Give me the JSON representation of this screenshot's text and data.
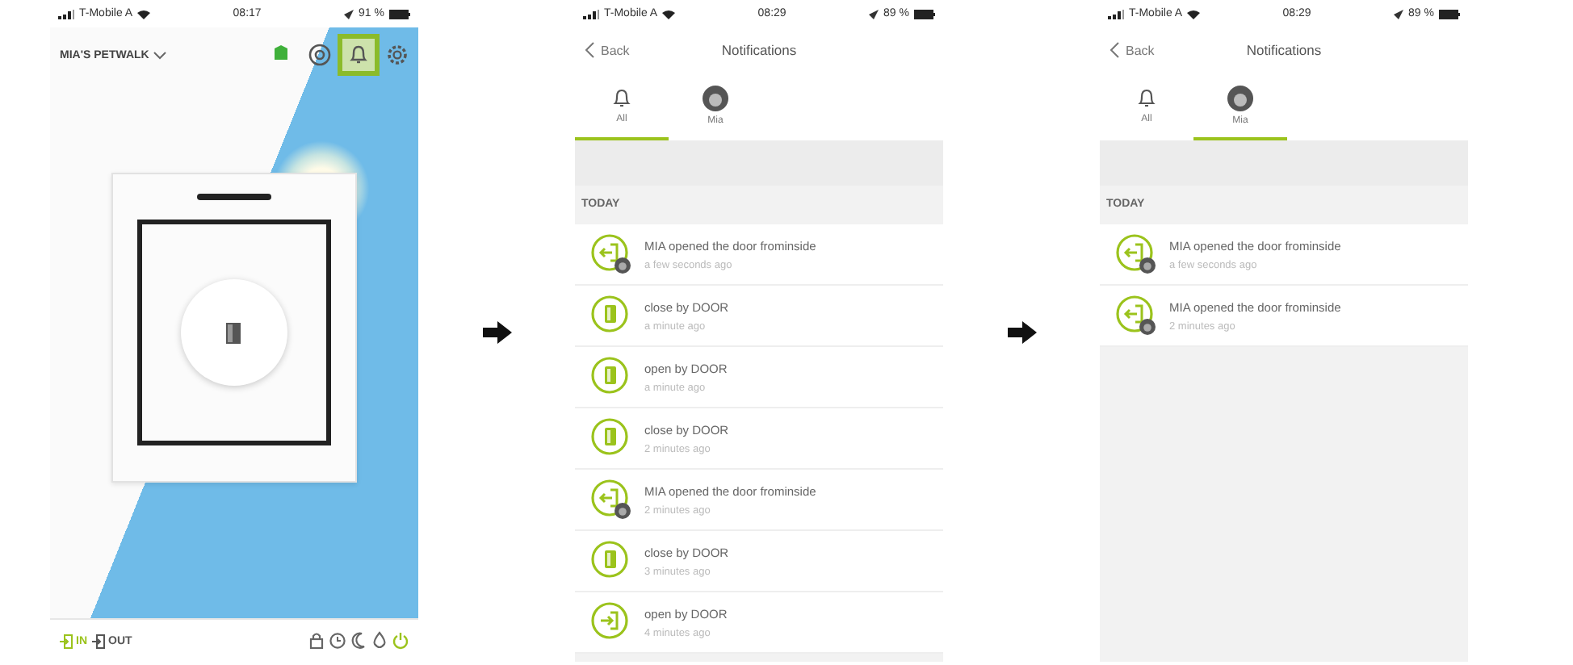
{
  "screens": [
    {
      "kind": "home",
      "status_bar": {
        "carrier": "T-Mobile A",
        "time": "08:17",
        "battery": "91 %"
      },
      "title": "MIA'S PETWALK",
      "header_icons": [
        {
          "kind": "status",
          "highlighted": false
        },
        {
          "kind": "camera",
          "highlighted": false
        },
        {
          "kind": "bell",
          "highlighted": true
        },
        {
          "kind": "gear",
          "highlighted": false
        }
      ],
      "directions": [
        {
          "label": "IN",
          "selected": true
        },
        {
          "label": "OUT",
          "selected": false
        }
      ],
      "modes": [
        {
          "kind": "lock",
          "active": false
        },
        {
          "kind": "clock",
          "active": false
        },
        {
          "kind": "moon",
          "active": false
        },
        {
          "kind": "drop",
          "active": false
        },
        {
          "kind": "power",
          "active": true
        }
      ]
    },
    {
      "kind": "notifications",
      "status_bar": {
        "carrier": "T-Mobile A",
        "time": "08:29",
        "battery": "89 %"
      },
      "back": "Back",
      "title": "Notifications",
      "tabs": [
        {
          "label": "All",
          "kind": "bell",
          "selected": true
        },
        {
          "label": "Mia",
          "kind": "pet",
          "selected": false
        }
      ],
      "section": "TODAY",
      "items": [
        {
          "kind": "exit",
          "pet": true,
          "title": "MIA opened the door frominside",
          "time": "a few seconds ago"
        },
        {
          "kind": "door",
          "pet": false,
          "title": "close by DOOR",
          "time": "a minute ago"
        },
        {
          "kind": "door",
          "pet": false,
          "title": "open by DOOR",
          "time": "a minute ago"
        },
        {
          "kind": "door",
          "pet": false,
          "title": "close by DOOR",
          "time": "2 minutes ago"
        },
        {
          "kind": "exit",
          "pet": true,
          "title": "MIA opened the door frominside",
          "time": "2 minutes ago"
        },
        {
          "kind": "door",
          "pet": false,
          "title": "close by DOOR",
          "time": "3 minutes ago"
        },
        {
          "kind": "enter",
          "pet": false,
          "title": "open by DOOR",
          "time": "4 minutes ago"
        }
      ]
    },
    {
      "kind": "notifications",
      "status_bar": {
        "carrier": "T-Mobile A",
        "time": "08:29",
        "battery": "89 %"
      },
      "back": "Back",
      "title": "Notifications",
      "tabs": [
        {
          "label": "All",
          "kind": "bell",
          "selected": false
        },
        {
          "label": "Mia",
          "kind": "pet",
          "selected": true
        }
      ],
      "section": "TODAY",
      "items": [
        {
          "kind": "exit",
          "pet": true,
          "title": "MIA opened the door frominside",
          "time": "a few seconds ago"
        },
        {
          "kind": "exit",
          "pet": true,
          "title": "MIA opened the door frominside",
          "time": "2 minutes ago"
        }
      ]
    }
  ]
}
